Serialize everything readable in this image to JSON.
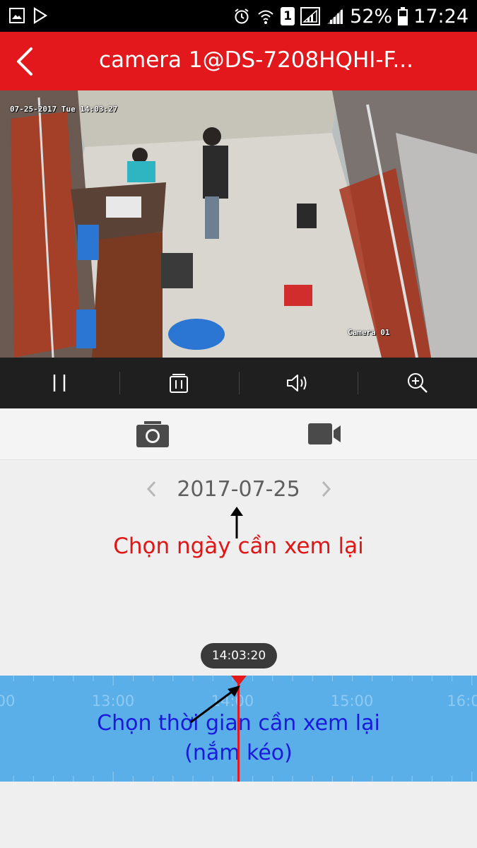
{
  "status_bar": {
    "battery": "52%",
    "time": "17:24",
    "sim": "1",
    "icons": [
      "gallery-icon",
      "play-store-icon",
      "alarm-icon",
      "wifi-icon",
      "sim-icon",
      "signal-icon",
      "battery-icon"
    ]
  },
  "header": {
    "title": "camera 1@DS-7208HQHI-F..."
  },
  "video": {
    "osd_datetime": "07-25-2017 Tue 14:03:27",
    "osd_camera": "Camera 01"
  },
  "controls": {
    "icons": [
      "pause-icon",
      "multi-window-icon",
      "volume-icon",
      "zoom-in-icon"
    ]
  },
  "capture": {
    "icons": [
      "camera-snapshot-icon",
      "video-record-icon"
    ]
  },
  "date_picker": {
    "date": "2017-07-25"
  },
  "annotations": {
    "date_hint": "Chọn ngày cần xem lại",
    "time_hint_line1": "Chọn thời gian cần xem lại",
    "time_hint_line2": "(nắm kéo)"
  },
  "timeline": {
    "current_time": "14:03:20",
    "labels": [
      "00",
      "13:00",
      "14:00",
      "15:00",
      "16:0"
    ]
  },
  "colors": {
    "accent_red": "#e2181c",
    "timeline_blue": "#5aafe8",
    "annotation_red": "#e01515",
    "annotation_blue": "#1a1adc"
  }
}
